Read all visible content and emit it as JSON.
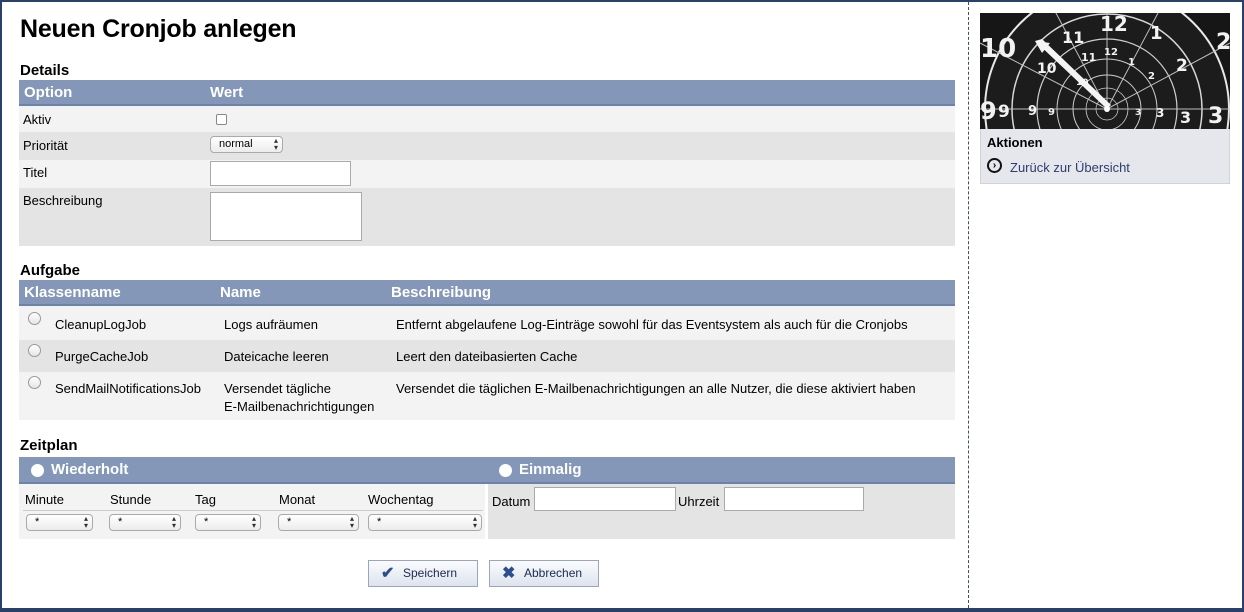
{
  "page": {
    "title": "Neuen Cronjob anlegen"
  },
  "details": {
    "heading": "Details",
    "col_option": "Option",
    "col_value": "Wert",
    "aktiv_label": "Aktiv",
    "prioritaet_label": "Priorität",
    "prioritaet_value": "normal",
    "titel_label": "Titel",
    "titel_value": "",
    "beschreibung_label": "Beschreibung",
    "beschreibung_value": ""
  },
  "aufgabe": {
    "heading": "Aufgabe",
    "col_class": "Klassenname",
    "col_name": "Name",
    "col_desc": "Beschreibung",
    "rows": [
      {
        "class": "CleanupLogJob",
        "name": "Logs aufräumen",
        "desc": "Entfernt abgelaufene Log-Einträge sowohl für das Eventsystem als auch für die Cronjobs"
      },
      {
        "class": "PurgeCacheJob",
        "name": "Dateicache leeren",
        "desc": "Leert den dateibasierten Cache"
      },
      {
        "class": "SendMailNotificationsJob",
        "name_line1": "Versendet tägliche",
        "name_line2": "E-Mailbenachrichtigungen",
        "desc": "Versendet die täglichen E-Mailbenachrichtigungen an alle Nutzer, die diese aktiviert haben"
      }
    ]
  },
  "zeitplan": {
    "heading": "Zeitplan",
    "wiederholt_label": "Wiederholt",
    "einmalig_label": "Einmalig",
    "fields": {
      "minute_label": "Minute",
      "minute_value": "*",
      "stunde_label": "Stunde",
      "stunde_value": "*",
      "tag_label": "Tag",
      "tag_value": "*",
      "monat_label": "Monat",
      "monat_value": "*",
      "wochentag_label": "Wochentag",
      "wochentag_value": "*"
    },
    "datum_label": "Datum",
    "datum_value": "",
    "uhrzeit_label": "Uhrzeit",
    "uhrzeit_value": ""
  },
  "buttons": {
    "save_label": "Speichern",
    "cancel_label": "Abbrechen"
  },
  "sidebar": {
    "actions_title": "Aktionen",
    "back_link": "Zurück zur Übersicht",
    "clock_numbers": [
      "10",
      "11",
      "12",
      "1",
      "2",
      "9",
      "3"
    ]
  },
  "colors": {
    "table_header": "#8497b8",
    "row_alt": "#e4e4e4",
    "frame": "#2b3f6b",
    "link": "#2c3e6e"
  }
}
